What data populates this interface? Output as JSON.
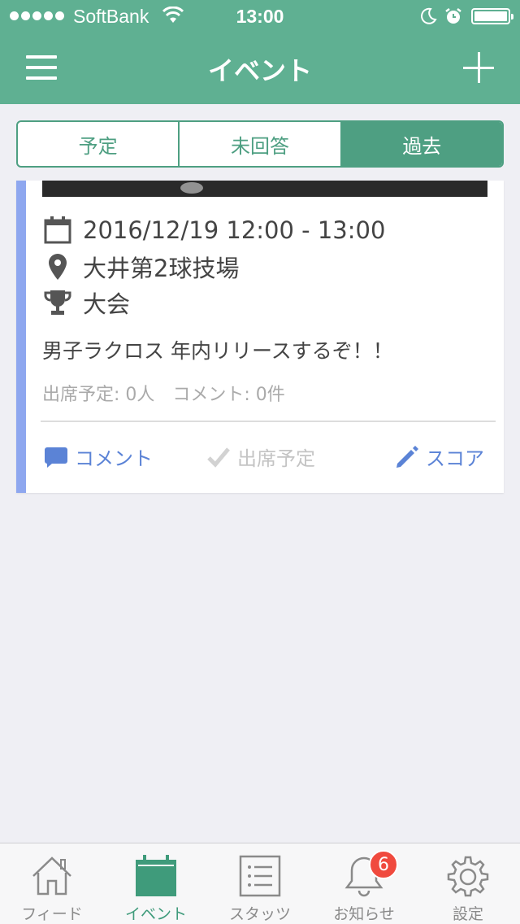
{
  "status_bar": {
    "carrier": "SoftBank",
    "time": "13:00"
  },
  "nav": {
    "title": "イベント"
  },
  "segments": [
    {
      "label": "予定",
      "active": false
    },
    {
      "label": "未回答",
      "active": false
    },
    {
      "label": "過去",
      "active": true
    }
  ],
  "event": {
    "datetime": "2016/12/19 12:00 - 13:00",
    "location": "大井第2球技場",
    "category": "大会",
    "description": "男子ラクロス 年内リリースするぞ！！",
    "meta": "出席予定: 0人　コメント: 0件",
    "actions": {
      "comment": "コメント",
      "attend": "出席予定",
      "score": "スコア"
    }
  },
  "colors": {
    "brand": "#5fb092",
    "segment": "#4e9f82",
    "card_accent": "#8ea7ef",
    "action": "#5b83d6",
    "badge": "#f04a3e"
  },
  "tabbar": {
    "tabs": [
      {
        "label": "フィード",
        "icon": "home-icon"
      },
      {
        "label": "イベント",
        "icon": "calendar-icon",
        "active": true
      },
      {
        "label": "スタッツ",
        "icon": "list-icon"
      },
      {
        "label": "お知らせ",
        "icon": "bell-icon",
        "badge": "6"
      },
      {
        "label": "設定",
        "icon": "gear-icon"
      }
    ]
  }
}
